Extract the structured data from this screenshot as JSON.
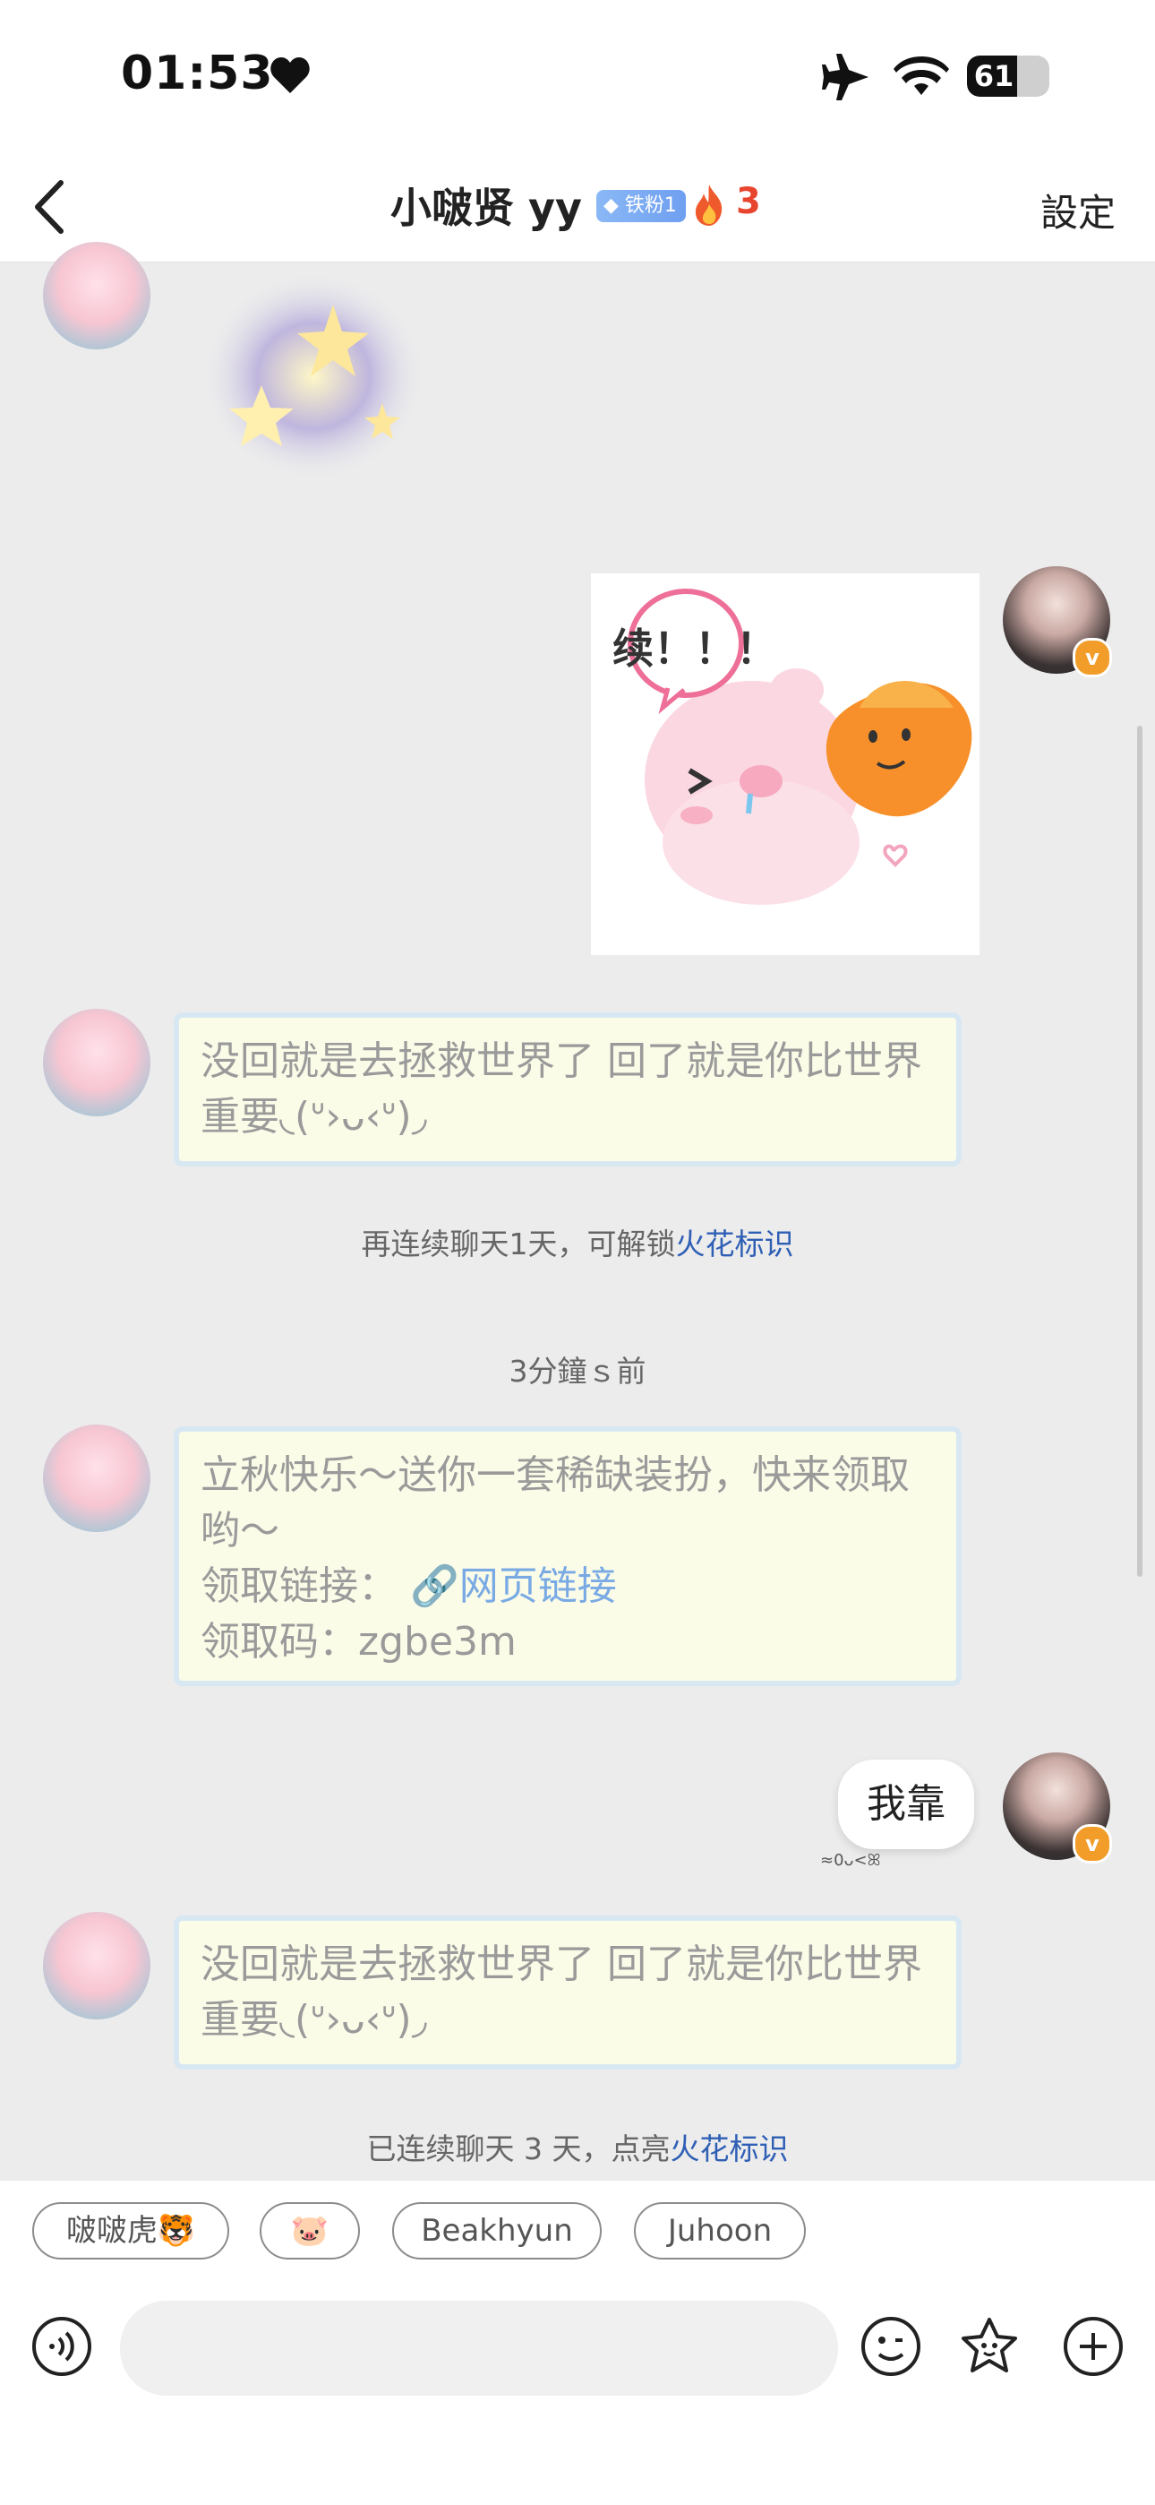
{
  "status_bar": {
    "time": "01:53",
    "battery": "61"
  },
  "header": {
    "title": "小啵贤 yy",
    "fan_badge": "铁粉1",
    "fire_count": "3",
    "settings": "設定"
  },
  "messages": {
    "m1": {
      "text": "没回就是去拯救世界了 回了就是你比世界重要◟(ᐡ›ᴗ‹ᐡ)◞"
    },
    "sys1": {
      "prefix": "再连续聊天1天，可解锁",
      "link": "火花标识"
    },
    "time1": "3分鐘ｓ前",
    "m2": {
      "line1": "立秋快乐～送你一套稀缺装扮，快来领取哟～",
      "link_label": "领取链接：",
      "link_text": "网页链接",
      "code": "领取码：zgbe3m"
    },
    "mine": {
      "text": "我靠",
      "reaction": "≈0ᴗ<ꕤ"
    },
    "m3": {
      "text": "没回就是去拯救世界了 回了就是你比世界重要◟(ᐡ›ᴗ‹ᐡ)◞"
    },
    "sys2": {
      "prefix": "已连续聊天 3 天，点亮",
      "link": "火花标识"
    },
    "sticker_text": "续！！！"
  },
  "quick_replies": [
    "啵啵虎🐯",
    "🐷",
    "Beakhyun",
    "Juhoon"
  ],
  "composer": {
    "placeholder": ""
  },
  "icons": {
    "back": "chevron-left-icon",
    "voice": "voice-icon",
    "emoji": "emoji-icon",
    "sticker": "sticker-icon",
    "plus": "plus-icon"
  },
  "colors": {
    "accent_link": "#2f5fb5",
    "fire": "#e8452f",
    "badge": "#6f9ff0"
  }
}
